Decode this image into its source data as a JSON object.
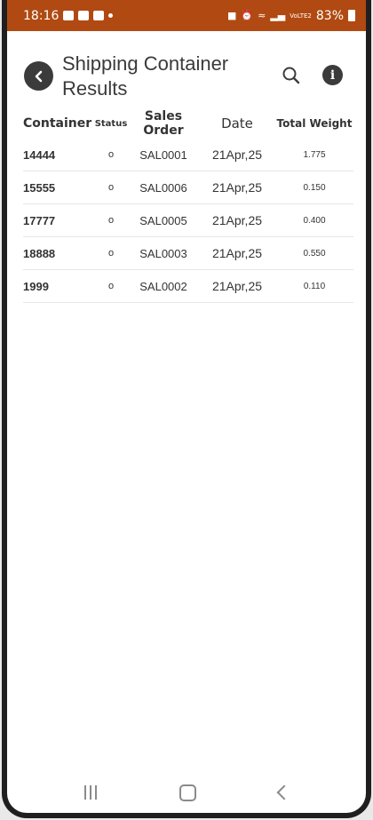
{
  "status_bar": {
    "time": "18:16",
    "network": "VoLTE2",
    "battery": "83%"
  },
  "header": {
    "title": "Shipping Container Results"
  },
  "table": {
    "headers": {
      "container": "Container",
      "status": "Status",
      "sales_order": "Sales Order",
      "date": "Date",
      "total_weight": "Total Weight"
    },
    "rows": [
      {
        "container": "14444",
        "status": "o",
        "sales_order": "SAL0001",
        "date": "21Apr,25",
        "total_weight": "1.775"
      },
      {
        "container": "15555",
        "status": "o",
        "sales_order": "SAL0006",
        "date": "21Apr,25",
        "total_weight": "0.150"
      },
      {
        "container": "17777",
        "status": "o",
        "sales_order": "SAL0005",
        "date": "21Apr,25",
        "total_weight": "0.400"
      },
      {
        "container": "18888",
        "status": "o",
        "sales_order": "SAL0003",
        "date": "21Apr,25",
        "total_weight": "0.550"
      },
      {
        "container": "1999",
        "status": "o",
        "sales_order": "SAL0002",
        "date": "21Apr,25",
        "total_weight": "0.110"
      }
    ]
  },
  "colors": {
    "status_bar": "#b04a12",
    "icon_dark": "#3b3b3b",
    "text": "#333333"
  },
  "icons": {
    "back": "chevron-left-icon",
    "search": "search-icon",
    "info": "info-icon"
  }
}
